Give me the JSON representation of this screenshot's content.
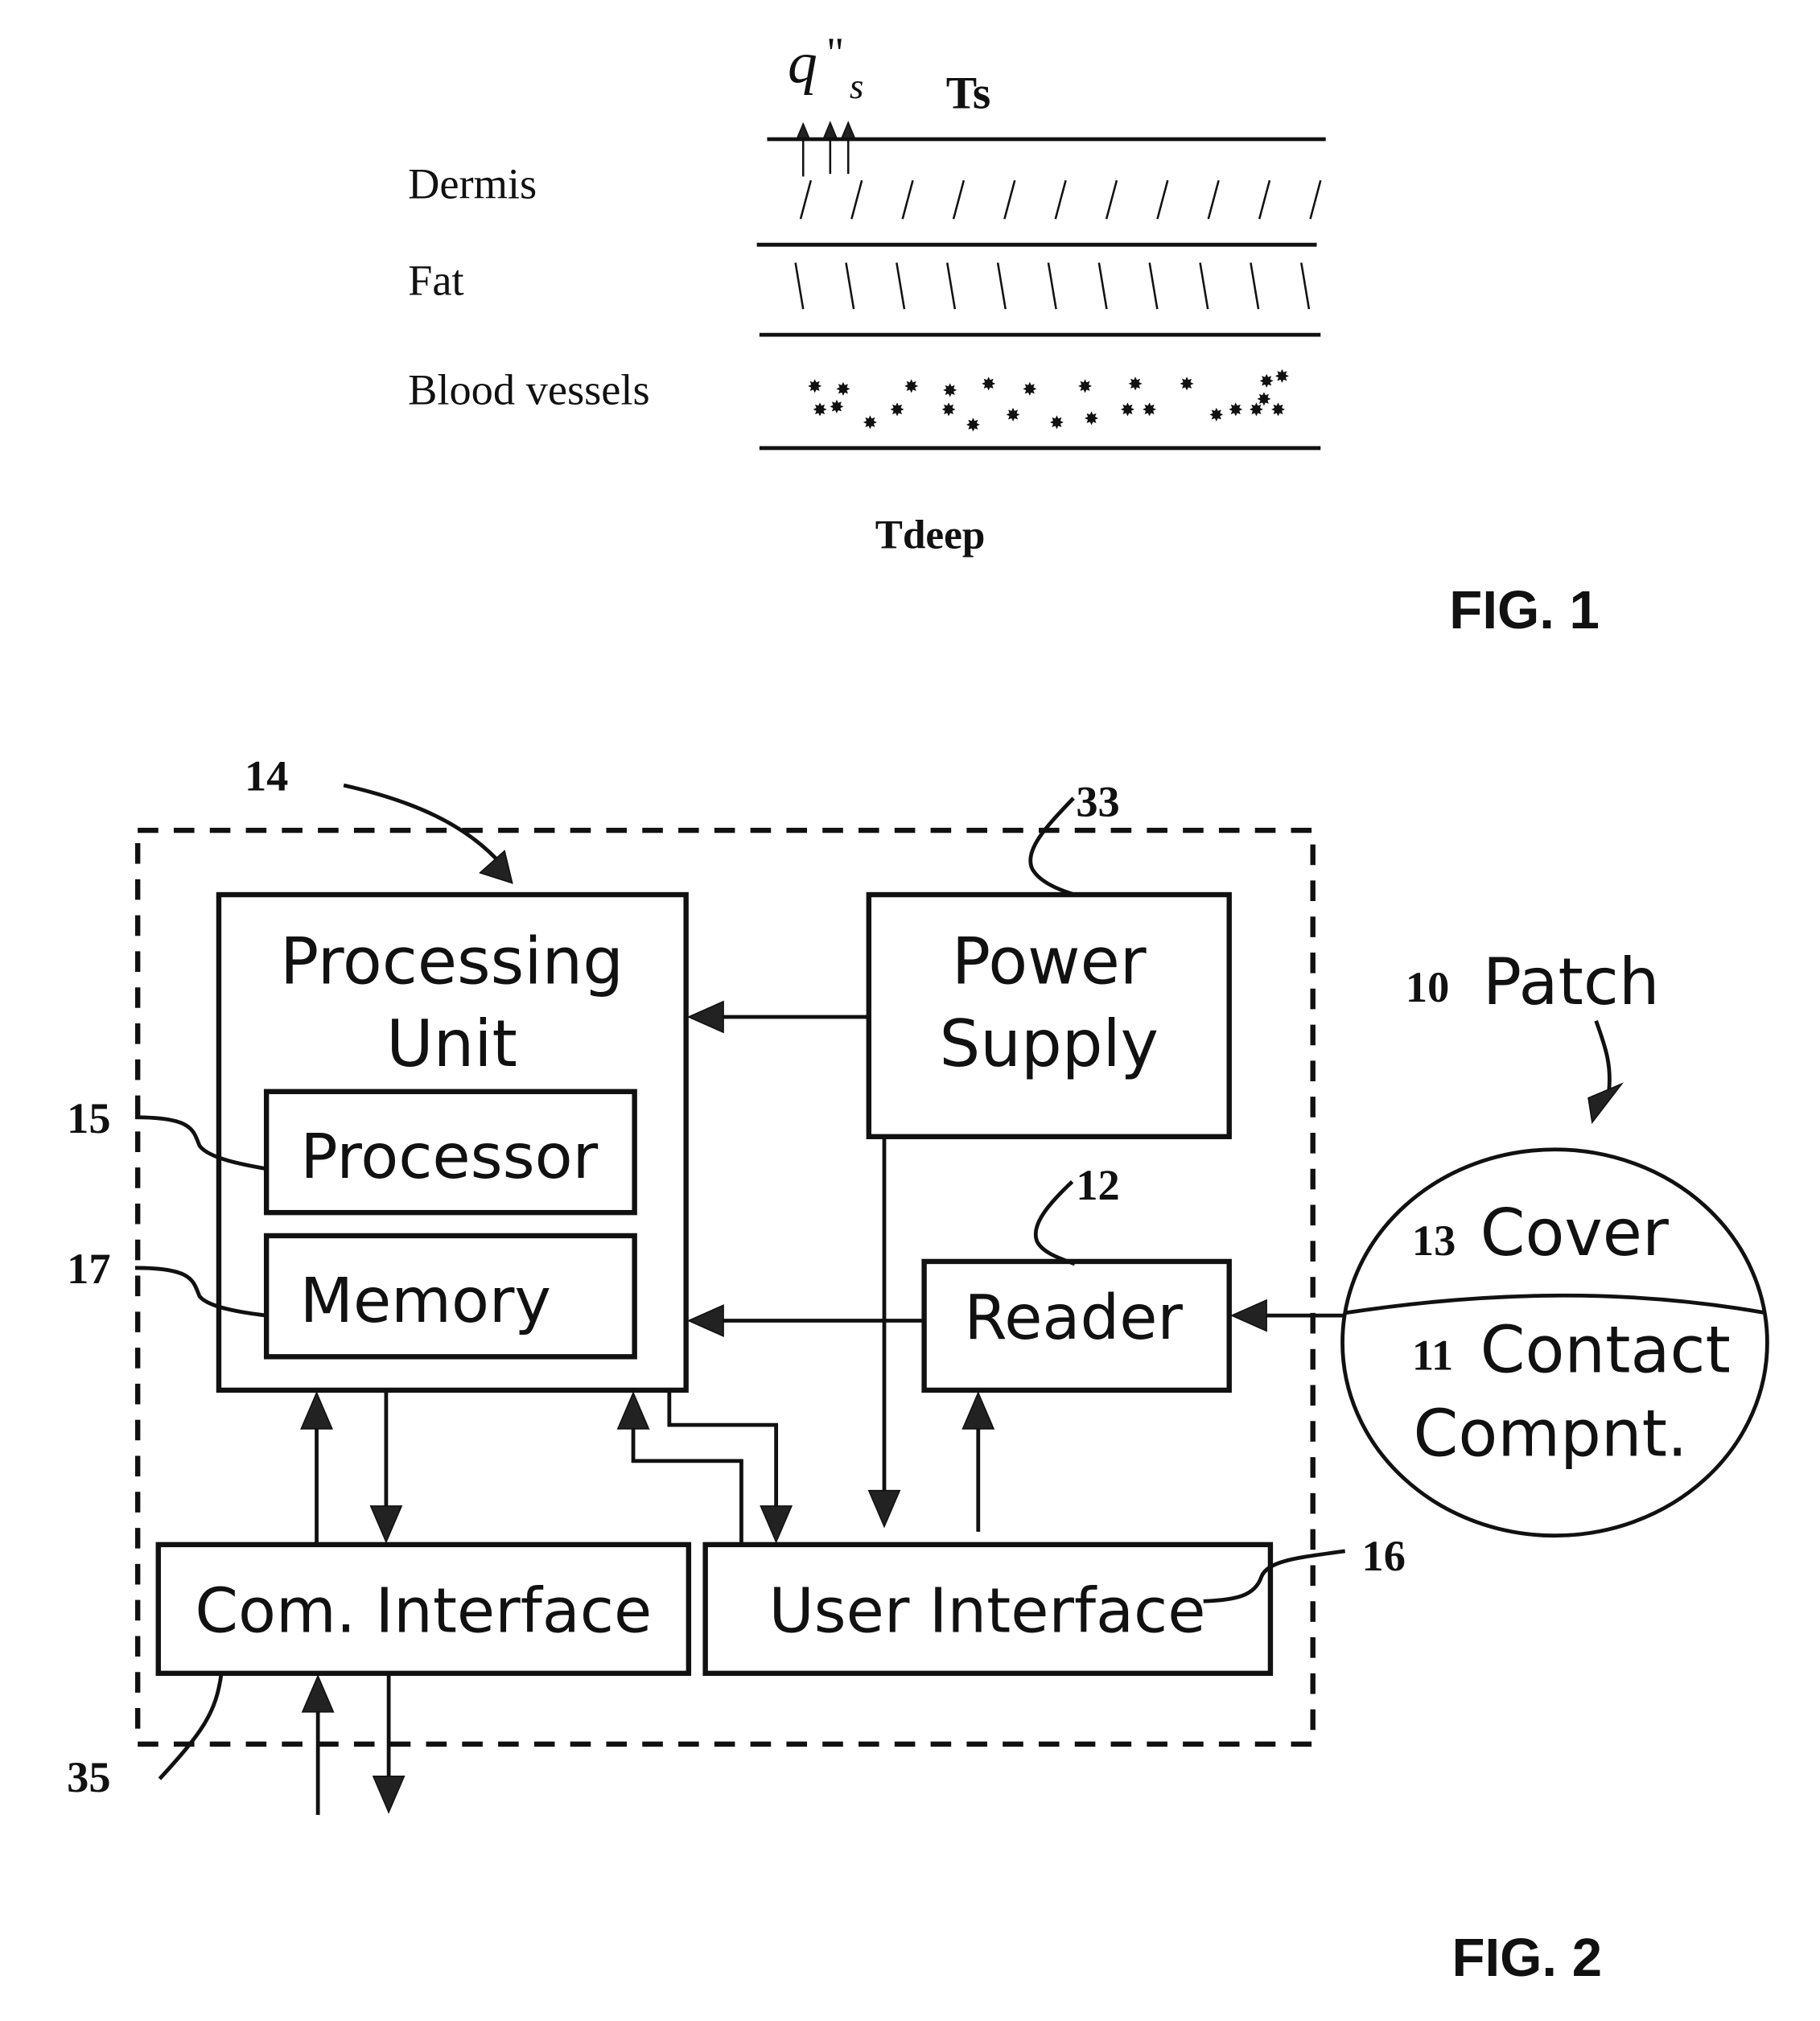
{
  "fig1": {
    "heat_flux_symbol": "q",
    "heat_flux_prime": "\"",
    "heat_flux_subscript": "s",
    "surface_temp_label": "Ts",
    "layers": [
      {
        "label": "Dermis"
      },
      {
        "label": "Fat"
      },
      {
        "label": "Blood vessels"
      }
    ],
    "deep_temp_label": "Tdeep",
    "caption": "FIG. 1"
  },
  "fig2": {
    "caption": "FIG. 2",
    "device_ref": "14",
    "blocks": {
      "processing_unit": {
        "label_line1": "Processing",
        "label_line2": "Unit"
      },
      "processor": {
        "label": "Processor",
        "ref": "15"
      },
      "memory": {
        "label": "Memory",
        "ref": "17"
      },
      "power_supply": {
        "label_line1": "Power",
        "label_line2": "Supply",
        "ref": "33"
      },
      "reader": {
        "label": "Reader",
        "ref": "12"
      },
      "com_interface": {
        "label": "Com. Interface",
        "ref": "35"
      },
      "user_interface": {
        "label": "User Interface",
        "ref": "16"
      }
    },
    "patch": {
      "ref": "10",
      "label": "Patch",
      "cover": {
        "ref": "13",
        "label": "Cover"
      },
      "contact": {
        "ref": "11",
        "label_line1": "Contact",
        "label_line2": "Compnt."
      }
    }
  }
}
